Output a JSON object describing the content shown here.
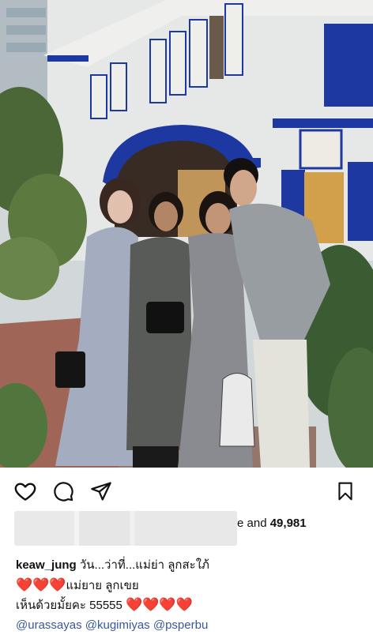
{
  "likes": {
    "suffix_text": "e and ",
    "count": "49,981"
  },
  "caption": {
    "username": "keaw_jung",
    "line1_text": " วัน...ว่าที่...แม่ย่า ลูกสะใภ้",
    "line2_hearts": "❤️❤️❤️",
    "line2_text": "แม่ยาย ลูกเขย",
    "line3_text": "เห็นด้วยมั้ยคะ 55555 ",
    "line3_hearts": "❤️❤️❤️❤️",
    "mentions": [
      "@urassayas",
      "@kugimiyas",
      "@psperbu"
    ]
  },
  "icons": {
    "like": "heart-outline-icon",
    "comment": "comment-bubble-icon",
    "share": "paper-plane-icon",
    "save": "bookmark-icon"
  },
  "colors": {
    "mention": "#3b5998",
    "heart": "#e0245e",
    "building_blue": "#1f3aa8"
  }
}
